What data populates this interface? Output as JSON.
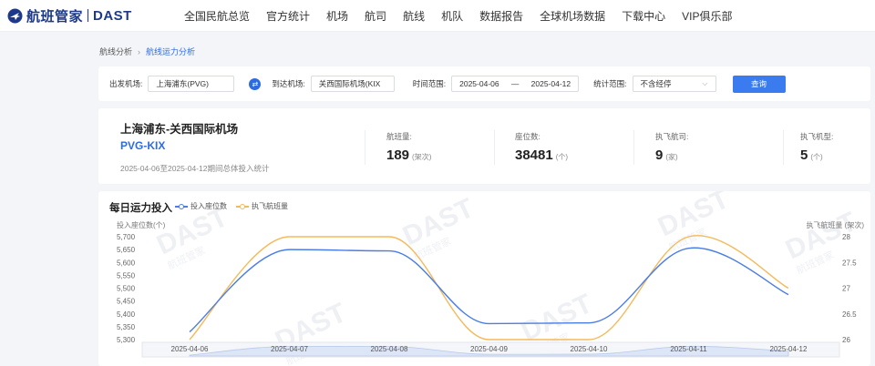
{
  "brand": {
    "name": "航班管家",
    "product": "DAST"
  },
  "nav": [
    "全国民航总览",
    "官方统计",
    "机场",
    "航司",
    "航线",
    "机队",
    "数据报告",
    "全球机场数据",
    "下载中心",
    "VIP俱乐部"
  ],
  "breadcrumb": {
    "parent": "航线分析",
    "current": "航线运力分析"
  },
  "filter": {
    "dep_label": "出发机场:",
    "dep_value": "上海浦东(PVG)",
    "arr_label": "到达机场:",
    "arr_value": "关西国际机场(KIX",
    "time_label": "时间范围:",
    "date_start": "2025-04-06",
    "date_sep": "—",
    "date_end": "2025-04-12",
    "stat_label": "统计范围:",
    "stat_value": "不含经停",
    "query_label": "查询"
  },
  "summary": {
    "title": "上海浦东-关西国际机场",
    "code": "PVG-KIX",
    "subtitle": "2025-04-06至2025-04-12期间总体投入统计",
    "stats": [
      {
        "label": "航班量:",
        "value": "189",
        "unit": "(架次)"
      },
      {
        "label": "座位数:",
        "value": "38481",
        "unit": "(个)"
      },
      {
        "label": "执飞航司:",
        "value": "9",
        "unit": "(家)"
      },
      {
        "label": "执飞机型:",
        "value": "5",
        "unit": "(个)"
      }
    ]
  },
  "chart": {
    "title": "每日运力投入",
    "watermark": "DAST",
    "watermark_sub": "航班管家",
    "colors": {
      "seats": "#4a7de6",
      "flights": "#f5b95a"
    }
  },
  "chart_data": {
    "type": "line",
    "categories": [
      "2025-04-06",
      "2025-04-07",
      "2025-04-08",
      "2025-04-09",
      "2025-04-10",
      "2025-04-11",
      "2025-04-12"
    ],
    "series": [
      {
        "name": "投入座位数",
        "axis": "left",
        "values": [
          5330,
          5650,
          5645,
          5362,
          5365,
          5655,
          5475
        ]
      },
      {
        "name": "执飞航班量",
        "axis": "right",
        "values": [
          26,
          28,
          28,
          26,
          26,
          28,
          27
        ]
      }
    ],
    "ylabel_left": "投入座位数(个)",
    "ylabel_right": "执飞航班量 (架次)",
    "ylim_left": [
      5300,
      5700
    ],
    "yticks_left": [
      "5,700",
      "5,650",
      "5,600",
      "5,550",
      "5,500",
      "5,450",
      "5,400",
      "5,350",
      "5,300"
    ],
    "ylim_right": [
      26,
      28
    ],
    "yticks_right": [
      "28",
      "27.5",
      "27",
      "26.5",
      "26"
    ],
    "grid": false,
    "legend": "top-left"
  }
}
